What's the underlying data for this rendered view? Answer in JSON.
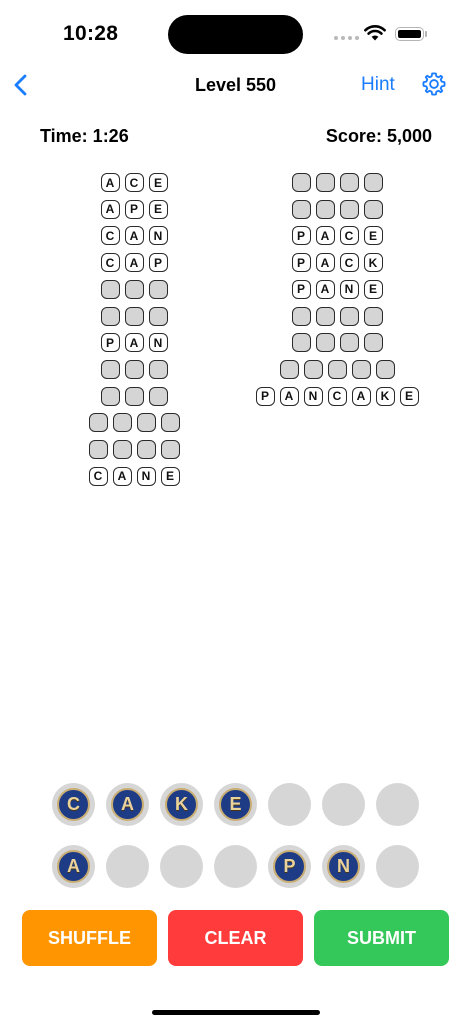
{
  "status": {
    "time": "10:28"
  },
  "nav": {
    "title": "Level 550",
    "hint_label": "Hint"
  },
  "stats": {
    "time": "Time: 1:26",
    "score": "Score: 5,000"
  },
  "left_words": [
    [
      "A",
      "C",
      "E"
    ],
    [
      "A",
      "P",
      "E"
    ],
    [
      "C",
      "A",
      "N"
    ],
    [
      "C",
      "A",
      "P"
    ],
    [
      "",
      "",
      ""
    ],
    [
      "",
      "",
      ""
    ],
    [
      "P",
      "A",
      "N"
    ],
    [
      "",
      "",
      ""
    ],
    [
      "",
      "",
      ""
    ],
    [
      "",
      "",
      "",
      ""
    ],
    [
      "",
      "",
      "",
      ""
    ],
    [
      "C",
      "A",
      "N",
      "E"
    ]
  ],
  "right_words": [
    [
      "",
      "",
      "",
      ""
    ],
    [
      "",
      "",
      "",
      ""
    ],
    [
      "P",
      "A",
      "C",
      "E"
    ],
    [
      "P",
      "A",
      "C",
      "K"
    ],
    [
      "P",
      "A",
      "N",
      "E"
    ],
    [
      "",
      "",
      "",
      ""
    ],
    [
      "",
      "",
      "",
      ""
    ],
    [
      "",
      "",
      "",
      "",
      ""
    ],
    [
      "P",
      "A",
      "N",
      "C",
      "A",
      "K",
      "E"
    ]
  ],
  "wheel": {
    "row1": [
      "C",
      "A",
      "K",
      "E",
      "",
      "",
      ""
    ],
    "row2": [
      "A",
      "",
      "",
      "",
      "P",
      "N",
      ""
    ]
  },
  "actions": {
    "shuffle": "SHUFFLE",
    "clear": "CLEAR",
    "submit": "SUBMIT"
  },
  "colors": {
    "accent": "#1a7cff",
    "shuffle": "#ff9500",
    "clear": "#ff3b3b",
    "submit": "#34c759",
    "coin": "#1e3c86",
    "coin_text": "#ead39a"
  }
}
